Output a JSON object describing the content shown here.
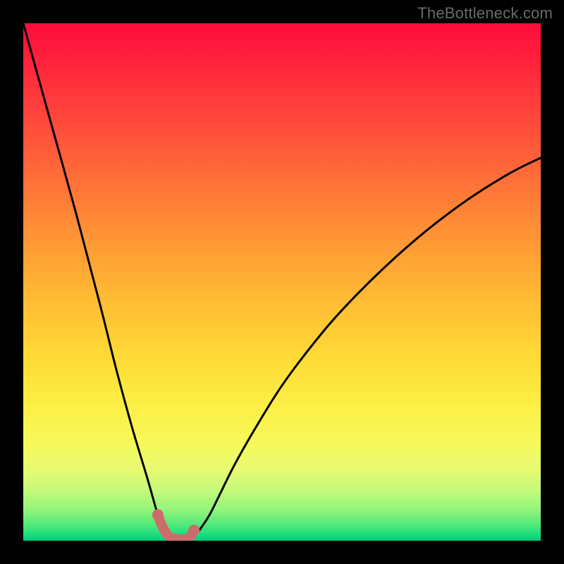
{
  "watermark": "TheBottleneck.com",
  "chart_data": {
    "type": "line",
    "title": "",
    "xlabel": "",
    "ylabel": "",
    "xlim": [
      0,
      100
    ],
    "ylim": [
      0,
      100
    ],
    "grid": false,
    "legend": false,
    "series": [
      {
        "name": "curve",
        "style": "black-line",
        "x": [
          0,
          5,
          10,
          15,
          18,
          21,
          24,
          26,
          27,
          28,
          29,
          30,
          31,
          32,
          33,
          34,
          36,
          38,
          41,
          45,
          50,
          56,
          62,
          70,
          78,
          86,
          94,
          100
        ],
        "values": [
          100,
          82,
          64,
          45,
          33,
          22,
          12,
          5,
          2.5,
          1,
          0.5,
          0.3,
          0.3,
          0.5,
          1,
          2,
          5,
          9,
          15,
          22,
          30,
          38,
          45,
          53,
          60,
          66,
          71,
          74
        ]
      },
      {
        "name": "markers",
        "style": "salmon-dot",
        "x": [
          26,
          27,
          28,
          29,
          30,
          31,
          32,
          33
        ],
        "values": [
          5,
          2.5,
          1,
          0.5,
          0.3,
          0.3,
          0.5,
          2
        ]
      }
    ],
    "annotations": []
  }
}
